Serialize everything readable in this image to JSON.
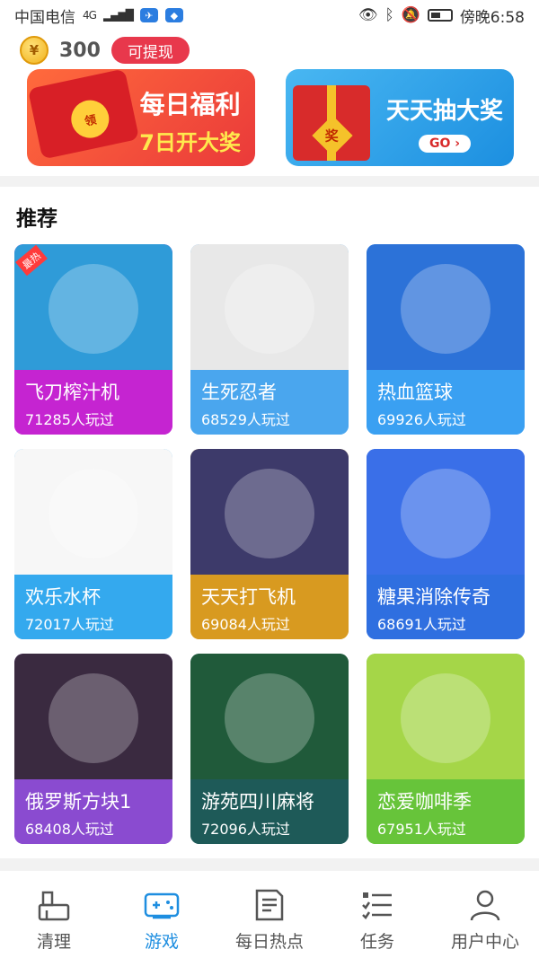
{
  "status_bar": {
    "carrier": "中国电信",
    "network": "4G",
    "time": "傍晚6:58"
  },
  "wallet": {
    "coin_symbol": "¥",
    "balance": "300",
    "withdraw_label": "可提现"
  },
  "banners": {
    "left": {
      "title": "每日福利",
      "subtitle": "7日开大奖",
      "envelope_label": "领"
    },
    "right": {
      "title": "天天抽大奖",
      "go_label": "GO",
      "gift_label": "奖"
    }
  },
  "section": {
    "title": "推荐"
  },
  "games": [
    {
      "name": "飞刀榨汁机",
      "plays": "71285人玩过",
      "tag": "最热",
      "color": "#c524d1",
      "art_color": "#2f9bd8"
    },
    {
      "name": "生死忍者",
      "plays": "68529人玩过",
      "color": "#4aa6ee",
      "art_color": "#e8e8e8"
    },
    {
      "name": "热血篮球",
      "plays": "69926人玩过",
      "color": "#3aa0f2",
      "art_color": "#2c72d8"
    },
    {
      "name": "欢乐水杯",
      "plays": "72017人玩过",
      "color": "#34a9ee",
      "art_color": "#f7f7f7"
    },
    {
      "name": "天天打飞机",
      "plays": "69084人玩过",
      "color": "#d89a20",
      "art_color": "#3d3a6a"
    },
    {
      "name": "糖果消除传奇",
      "plays": "68691人玩过",
      "color": "#2f6fe0",
      "art_color": "#3a6fe8"
    },
    {
      "name": "俄罗斯方块1",
      "plays": "68408人玩过",
      "color": "#8a4bd0",
      "art_color": "#3a2a40"
    },
    {
      "name": "游苑四川麻将",
      "plays": "72096人玩过",
      "color": "#1e5a58",
      "art_color": "#205a3a"
    },
    {
      "name": "恋爱咖啡季",
      "plays": "67951人玩过",
      "color": "#67c43a",
      "art_color": "#a5d648"
    }
  ],
  "tabs": [
    {
      "label": "清理",
      "icon": "broom-icon",
      "active": false
    },
    {
      "label": "游戏",
      "icon": "gamepad-icon",
      "active": true
    },
    {
      "label": "每日热点",
      "icon": "document-icon",
      "active": false
    },
    {
      "label": "任务",
      "icon": "checklist-icon",
      "active": false
    },
    {
      "label": "用户中心",
      "icon": "user-icon",
      "active": false
    }
  ],
  "colors": {
    "accent": "#1e8ee0",
    "withdraw": "#e8384c",
    "inactive_tab": "#555555"
  }
}
